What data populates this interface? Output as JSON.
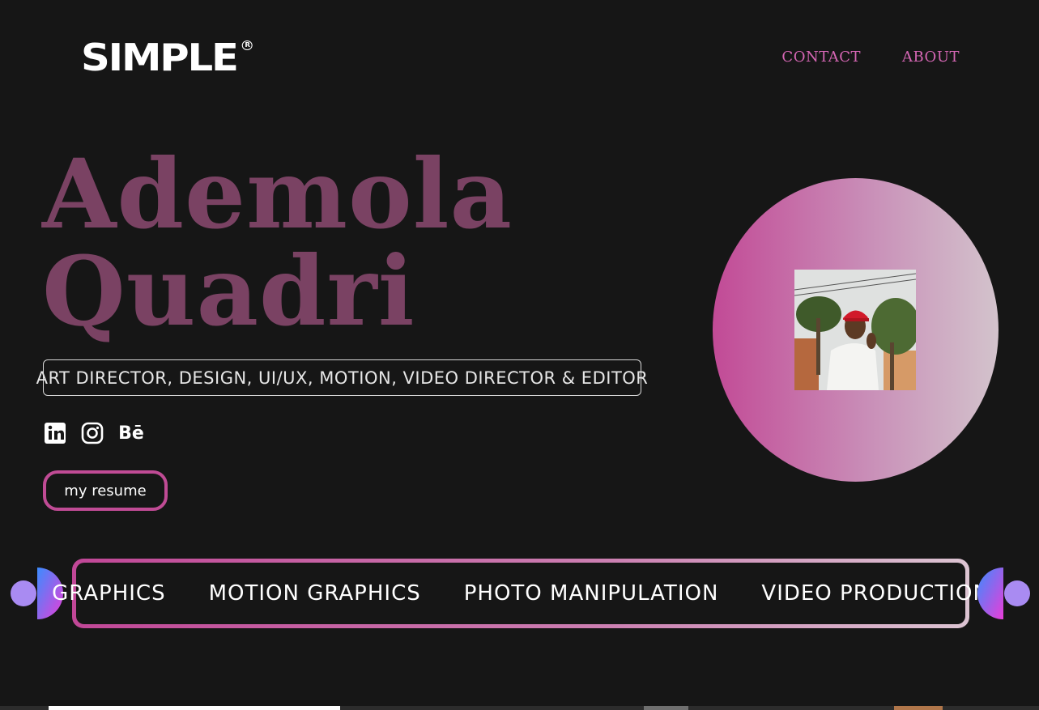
{
  "header": {
    "logo_text": "SIMPLE",
    "logo_mark": "R",
    "nav": [
      {
        "label": "CONTACT"
      },
      {
        "label": "ABOUT"
      }
    ]
  },
  "hero": {
    "first_name": "Ademola",
    "last_name": "Quadri",
    "roles": "ART DIRECTOR, DESIGN, UI/UX, MOTION, VIDEO DIRECTOR & EDITOR",
    "socials": [
      {
        "icon": "linkedin-icon"
      },
      {
        "icon": "instagram-icon"
      },
      {
        "icon": "behance-icon",
        "label": "Bē"
      }
    ],
    "resume_label": "my resume"
  },
  "services": [
    {
      "label": "GRAPHICS"
    },
    {
      "label": "MOTION GRAPHICS"
    },
    {
      "label": "PHOTO MANIPULATION"
    },
    {
      "label": "VIDEO PRODUCTION"
    }
  ],
  "colors": {
    "background": "#161616",
    "accent_pink": "#d466b3",
    "name_color": "#7a4263",
    "button_border": "#c04b95"
  }
}
